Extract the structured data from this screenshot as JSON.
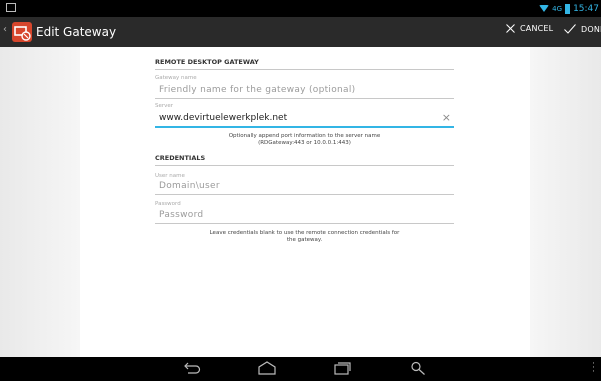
{
  "action_bar": {
    "title": "Edit Gateway",
    "cancel_label": "CANCEL",
    "done_label": "DONE"
  },
  "status_bar": {
    "network": "4G",
    "time": "15:47"
  },
  "form": {
    "section_gateway": "REMOTE DESKTOP GATEWAY",
    "gateway_name_label": "Gateway name",
    "gateway_name_placeholder": "Friendly name for the gateway (optional)",
    "server_label": "Server",
    "server_value": "www.devirtuelewerkplek.net",
    "server_hint_line1": "Optionally append port information to the server name",
    "server_hint_line2": "(RDGateway:443 or 10.0.0.1:443)",
    "section_credentials": "CREDENTIALS",
    "username_label": "User name",
    "username_placeholder": "Domain\\user",
    "password_label": "Password",
    "password_placeholder": "Password",
    "credentials_hint_line1": "Leave credentials blank to use the remote connection credentials for",
    "credentials_hint_line2": "the gateway."
  },
  "icons": {
    "back": "back-icon",
    "home": "home-icon",
    "recents": "recent-apps-icon",
    "search": "search-icon"
  },
  "colors": {
    "accent": "#33b5e5",
    "app_icon": "#d6462c",
    "action_bar": "#2a2a2a"
  }
}
